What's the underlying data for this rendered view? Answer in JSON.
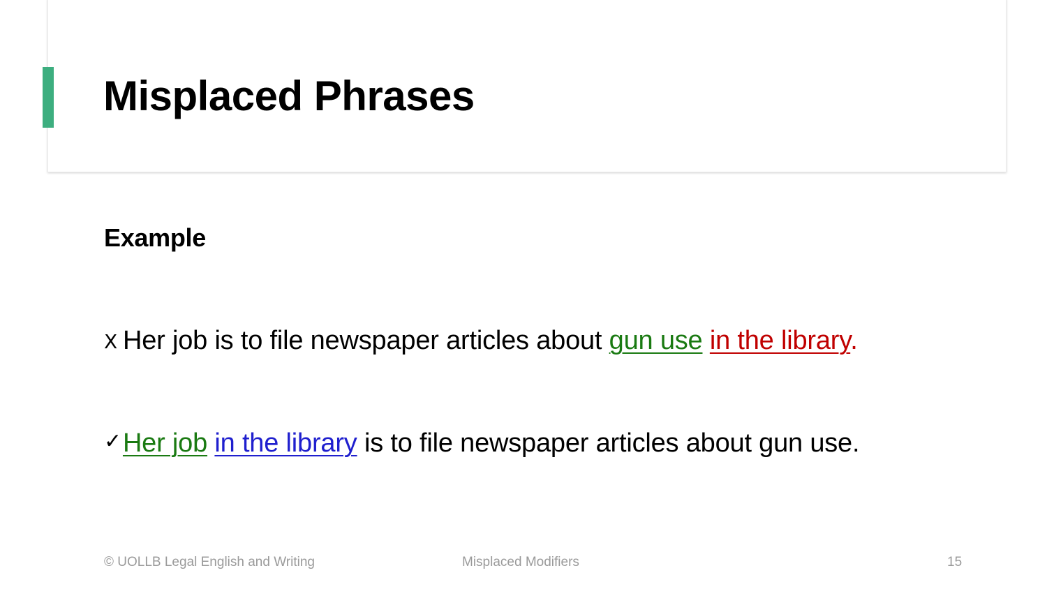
{
  "title": "Misplaced Phrases",
  "section_heading": "Example",
  "colors": {
    "accent": "#3dae7f",
    "green": "#1a7a12",
    "red": "#c00000",
    "blue": "#1f1fce",
    "footer_gray": "#9a9a9a"
  },
  "examples": [
    {
      "mark": "X",
      "mark_icon": "cross-mark-icon",
      "segments": [
        {
          "text": "Her job is to file newspaper articles about ",
          "style": "plain"
        },
        {
          "text": "gun use",
          "style": "green-underline"
        },
        {
          "text": " ",
          "style": "plain"
        },
        {
          "text": "in the library",
          "style": "red-underline"
        },
        {
          "text": ".",
          "style": "red"
        }
      ]
    },
    {
      "mark": "✓",
      "mark_icon": "check-mark-icon",
      "segments": [
        {
          "text": "Her job",
          "style": "green-underline"
        },
        {
          "text": " ",
          "style": "plain"
        },
        {
          "text": "in the library",
          "style": "blue-underline"
        },
        {
          "text": " is to file newspaper articles about gun use.",
          "style": "plain"
        }
      ]
    }
  ],
  "footer": {
    "copyright": "© UOLLB Legal English and Writing",
    "topic": "Misplaced Modifiers",
    "page_number": "15"
  }
}
